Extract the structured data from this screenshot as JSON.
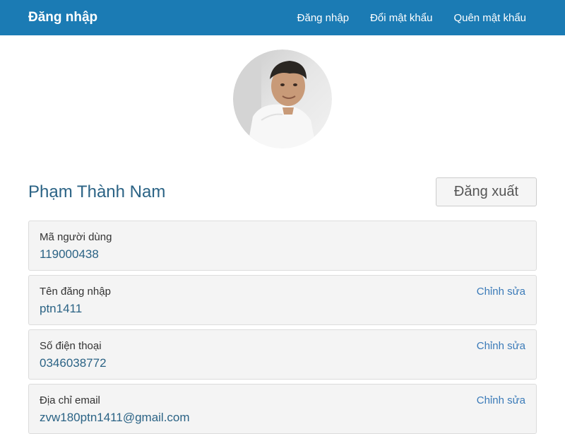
{
  "navbar": {
    "brand": "Đăng nhập",
    "links": [
      "Đăng nhập",
      "Đổi mật khẩu",
      "Quên mật khẩu"
    ],
    "background": "#1b7bb4"
  },
  "profile": {
    "name": "Phạm Thành Nam",
    "logout_label": "Đăng xuất"
  },
  "fields": [
    {
      "label": "Mã người dùng",
      "value": "119000438",
      "edit": ""
    },
    {
      "label": "Tên đăng nhập",
      "value": "ptn1411",
      "edit": "Chỉnh sửa"
    },
    {
      "label": "Số điện thoại",
      "value": "0346038772",
      "edit": "Chỉnh sửa"
    },
    {
      "label": "Địa chỉ email",
      "value": "zvw180ptn1411@gmail.com",
      "edit": "Chỉnh sửa"
    }
  ]
}
